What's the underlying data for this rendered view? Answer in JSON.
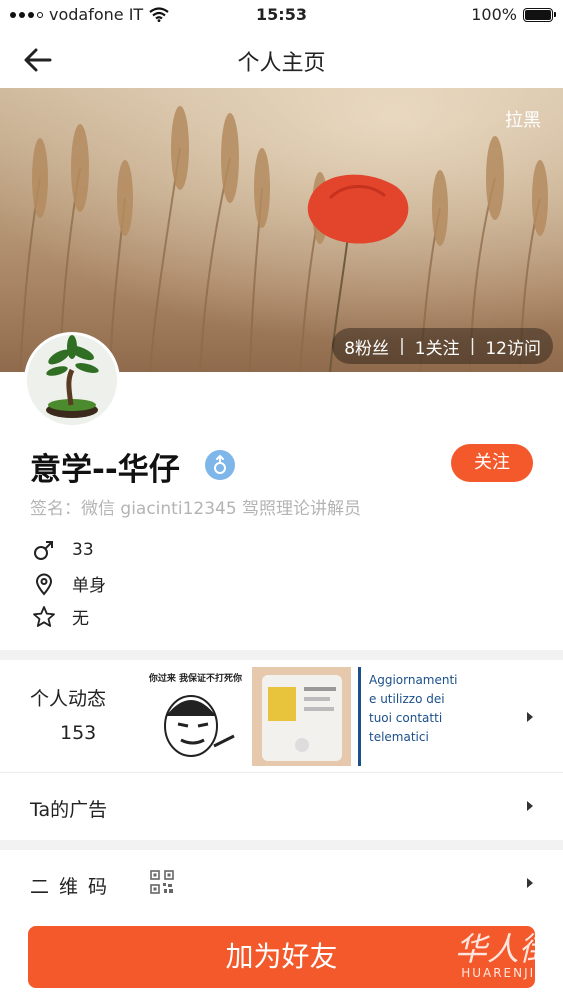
{
  "status_bar": {
    "carrier": "vodafone IT",
    "time": "15:53",
    "battery_percent": "100%",
    "battery_level": 1.0,
    "signal_bars": 3
  },
  "nav": {
    "title": "个人主页",
    "back_icon": "arrow-left-icon"
  },
  "cover": {
    "block_label": "拉黑",
    "fans": "8粉丝",
    "following": "1关注",
    "visits": "12访问",
    "separator": "|"
  },
  "profile": {
    "username": "意学--华仔",
    "gender_icon": "male-icon",
    "follow_label": "关注",
    "signature": "签名：微信 giacinti12345 驾照理论讲解员",
    "age": "33",
    "relationship": "单身",
    "zodiac": "无"
  },
  "feed": {
    "label": "个人动态",
    "count": "153",
    "thumb1_caption": "你过来 我保证不打死你",
    "thumb3_text": "Aggiornamenti e utilizzo dei tuoi contatti telematici"
  },
  "ads": {
    "label": "Ta的广告"
  },
  "qr": {
    "label": "二维码",
    "icon": "qr-code-icon"
  },
  "bottom": {
    "add_friend_label": "加为好友",
    "watermark_cn": "华人街",
    "watermark_en": "HUARENJIE"
  },
  "colors": {
    "accent": "#f4592c",
    "gender_badge": "#7fb6ea",
    "signature_gray": "#b4b4b4"
  }
}
